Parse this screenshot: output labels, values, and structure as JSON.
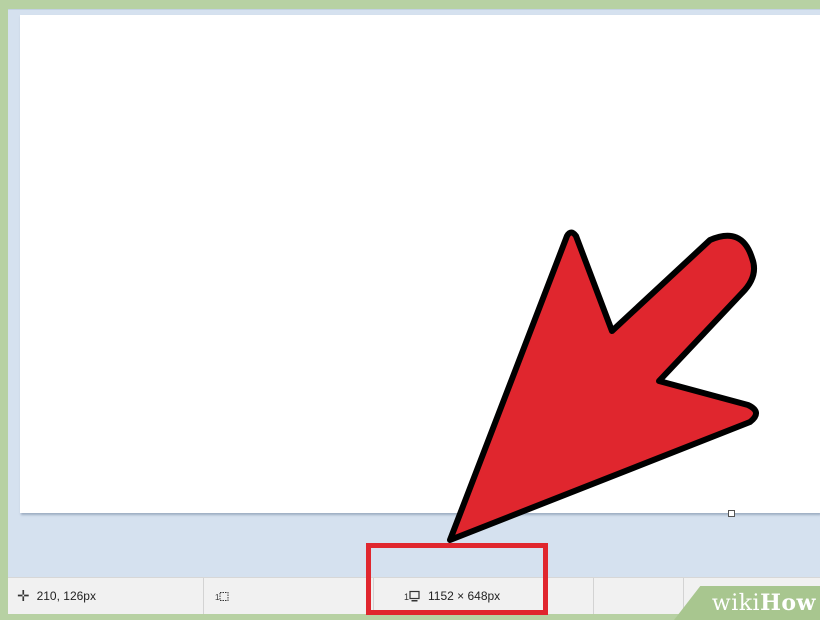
{
  "status_bar": {
    "cursor_position": "210, 126px",
    "selection_size": "",
    "image_size": "1152 × 648px"
  },
  "icons": {
    "cursor": "move-crosshair-icon",
    "selection": "selection-rect-icon",
    "image_size": "image-size-icon"
  },
  "annotation": {
    "arrow_color": "#e0262e",
    "box_color": "#e0262e"
  },
  "watermark": {
    "wiki": "wiki",
    "how": "How"
  }
}
